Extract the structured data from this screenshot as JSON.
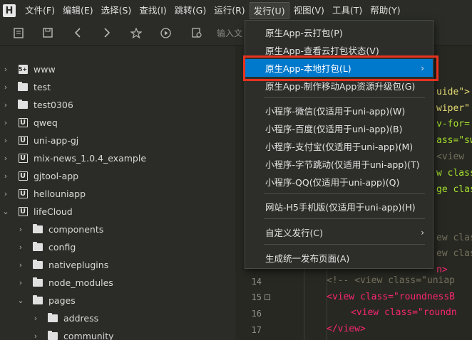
{
  "app": {
    "logo_text": "H"
  },
  "menubar": {
    "items": [
      {
        "label": "文件(F)"
      },
      {
        "label": "编辑(E)"
      },
      {
        "label": "选择(S)"
      },
      {
        "label": "查找(I)"
      },
      {
        "label": "跳转(G)"
      },
      {
        "label": "运行(R)"
      },
      {
        "label": "发行(U)"
      },
      {
        "label": "视图(V)"
      },
      {
        "label": "工具(T)"
      },
      {
        "label": "帮助(Y)"
      }
    ]
  },
  "toolbar": {
    "search_placeholder": "输入文",
    "icons": [
      "new-file-icon",
      "save-icon",
      "back-icon",
      "forward-icon",
      "bookmark-star-icon",
      "run-icon",
      "preview-icon"
    ]
  },
  "sidebar": {
    "items": [
      {
        "label": "www",
        "icon": "project-5plus-icon",
        "logo": "5+",
        "expanded": false,
        "level": 0
      },
      {
        "label": "test",
        "icon": "folder-icon",
        "expanded": false,
        "level": 0
      },
      {
        "label": "test0306",
        "icon": "folder-icon",
        "expanded": false,
        "level": 0
      },
      {
        "label": "qweq",
        "icon": "uniapp-project-icon",
        "logo": "U",
        "expanded": false,
        "level": 0
      },
      {
        "label": "uni-app-gj",
        "icon": "uniapp-project-icon",
        "logo": "U",
        "expanded": false,
        "level": 0
      },
      {
        "label": "mix-news_1.0.4_example",
        "icon": "uniapp-project-icon",
        "logo": "U",
        "expanded": false,
        "level": 0
      },
      {
        "label": "gjtool-app",
        "icon": "uniapp-project-icon",
        "logo": "U",
        "expanded": false,
        "level": 0
      },
      {
        "label": "hellouniapp",
        "icon": "uniapp-project-icon",
        "logo": "U",
        "expanded": false,
        "level": 0
      },
      {
        "label": "lifeCloud",
        "icon": "uniapp-project-icon",
        "logo": "U",
        "expanded": true,
        "level": 0
      },
      {
        "label": "components",
        "icon": "folder-icon",
        "expanded": false,
        "level": 1
      },
      {
        "label": "config",
        "icon": "folder-icon",
        "expanded": false,
        "level": 1
      },
      {
        "label": "nativeplugins",
        "icon": "folder-icon",
        "expanded": false,
        "level": 1
      },
      {
        "label": "node_modules",
        "icon": "folder-icon",
        "expanded": false,
        "level": 1
      },
      {
        "label": "pages",
        "icon": "folder-icon",
        "expanded": true,
        "level": 1
      },
      {
        "label": "address",
        "icon": "folder-icon",
        "expanded": false,
        "level": 2
      },
      {
        "label": "community",
        "icon": "folder-icon",
        "expanded": false,
        "level": 2
      }
    ]
  },
  "editor": {
    "line_numbers": [
      "14",
      "15",
      "16",
      "17"
    ],
    "visible_fragments": [
      "uide\">",
      "wiper\"",
      "v-for=",
      "ass=\"sw",
      "<view",
      "w class",
      "ge clas",
      "ew clas",
      "ew clas",
      "n>"
    ],
    "lines": [
      "<!-- <view class=\"uniap",
      "<view class=\"roundnessB",
      "<view class=\"roundn",
      "</view>"
    ]
  },
  "dropdown": {
    "items": [
      {
        "label": "原生App-云打包(P)",
        "submenu": false
      },
      {
        "label": "原生App-查看云打包状态(V)",
        "submenu": false
      },
      {
        "label": "原生App-本地打包(L)",
        "submenu": true,
        "selected": true
      },
      {
        "label": "原生App-制作移动App资源升级包(G)",
        "submenu": false
      },
      {
        "label": "小程序-微信(仅适用于uni-app)(W)",
        "submenu": false
      },
      {
        "label": "小程序-百度(仅适用于uni-app)(B)",
        "submenu": false
      },
      {
        "label": "小程序-支付宝(仅适用于uni-app)(M)",
        "submenu": false
      },
      {
        "label": "小程序-字节跳动(仅适用于uni-app)(T)",
        "submenu": false
      },
      {
        "label": "小程序-QQ(仅适用于uni-app)(Q)",
        "submenu": false
      },
      {
        "label": "网站-H5手机版(仅适用于uni-app)(H)",
        "submenu": false
      },
      {
        "label": "自定义发行(C)",
        "submenu": true
      },
      {
        "label": "生成统一发布页面(A)",
        "submenu": false
      }
    ]
  },
  "colors": {
    "selection": "#0079cc",
    "highlight_box": "#e8321f",
    "background": "#272822"
  }
}
